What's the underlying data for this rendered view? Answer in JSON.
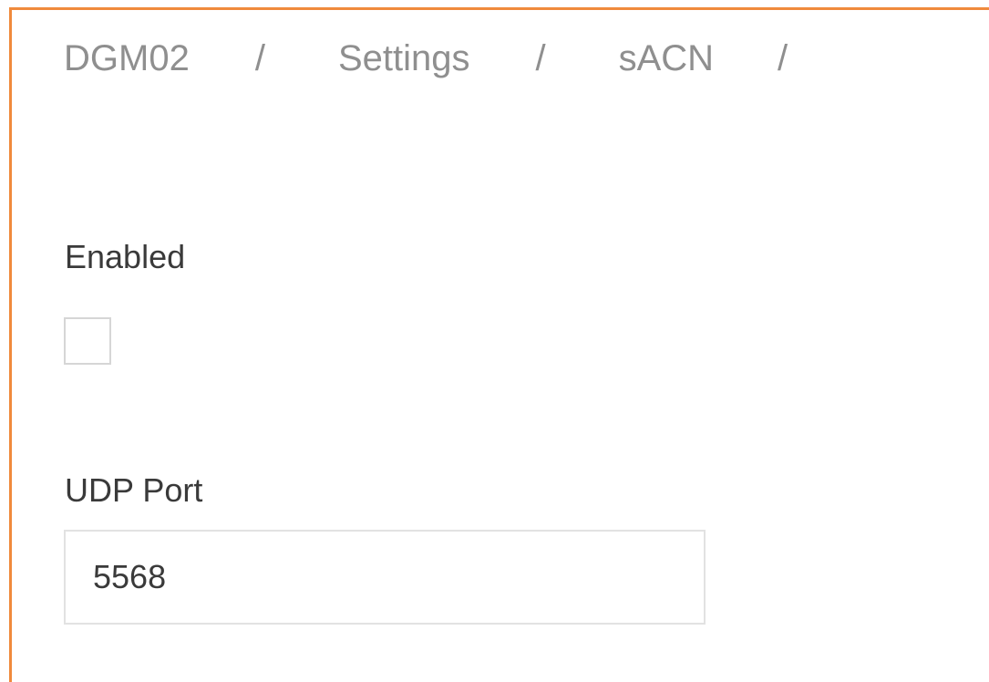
{
  "breadcrumb": {
    "items": [
      "DGM02",
      "Settings",
      "sACN"
    ],
    "separator": "/"
  },
  "form": {
    "enabled": {
      "label": "Enabled",
      "checked": false
    },
    "udp_port": {
      "label": "UDP Port",
      "value": "5568"
    }
  },
  "colors": {
    "accent_border": "#f08a3c",
    "breadcrumb_text": "#8f8f8f",
    "label_text": "#3a3a3a"
  }
}
